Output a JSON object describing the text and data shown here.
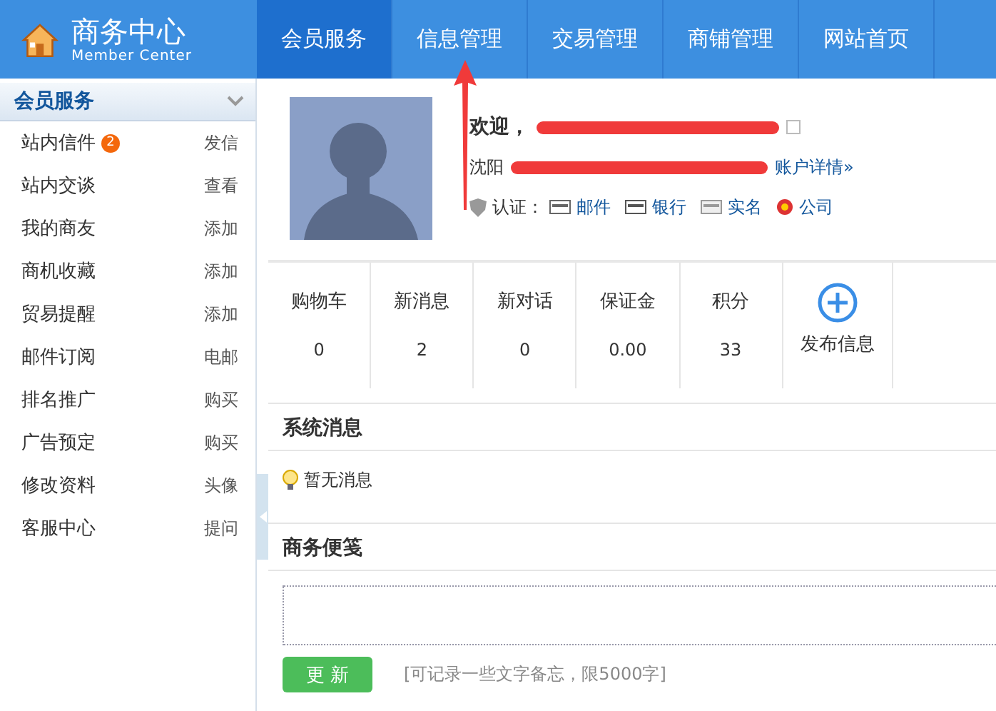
{
  "header": {
    "title": "商务中心",
    "subtitle": "Member Center"
  },
  "nav": [
    {
      "label": "会员服务",
      "selected": true
    },
    {
      "label": "信息管理",
      "selected": false
    },
    {
      "label": "交易管理",
      "selected": false
    },
    {
      "label": "商铺管理",
      "selected": false
    },
    {
      "label": "网站首页",
      "selected": false
    }
  ],
  "sidebar": {
    "title": "会员服务",
    "items": [
      {
        "label": "站内信件",
        "badge": "2",
        "action": "发信"
      },
      {
        "label": "站内交谈",
        "action": "查看"
      },
      {
        "label": "我的商友",
        "action": "添加"
      },
      {
        "label": "商机收藏",
        "action": "添加"
      },
      {
        "label": "贸易提醒",
        "action": "添加"
      },
      {
        "label": "邮件订阅",
        "action": "电邮"
      },
      {
        "label": "排名推广",
        "action": "购买"
      },
      {
        "label": "广告预定",
        "action": "购买"
      },
      {
        "label": "修改资料",
        "action": "头像"
      },
      {
        "label": "客服中心",
        "action": "提问"
      }
    ]
  },
  "profile": {
    "welcome": "欢迎，",
    "checked": false,
    "location": "沈阳",
    "account_link": "账户详情»",
    "cert_label": "认证：",
    "certs": [
      {
        "kind": "mail",
        "label": "邮件"
      },
      {
        "kind": "bank",
        "label": "银行"
      },
      {
        "kind": "id",
        "label": "实名"
      },
      {
        "kind": "company",
        "label": "公司"
      }
    ]
  },
  "stats": [
    {
      "label": "购物车",
      "value": "0"
    },
    {
      "label": "新消息",
      "value": "2"
    },
    {
      "label": "新对话",
      "value": "0"
    },
    {
      "label": "保证金",
      "value": "0.00"
    },
    {
      "label": "积分",
      "value": "33"
    }
  ],
  "publish": {
    "label": "发布信息"
  },
  "system_messages": {
    "title": "系统消息",
    "empty": "暂无消息"
  },
  "notes": {
    "title": "商务便笺",
    "button": "更 新",
    "hint": "[可记录一些文字备忘，限5000字]"
  }
}
